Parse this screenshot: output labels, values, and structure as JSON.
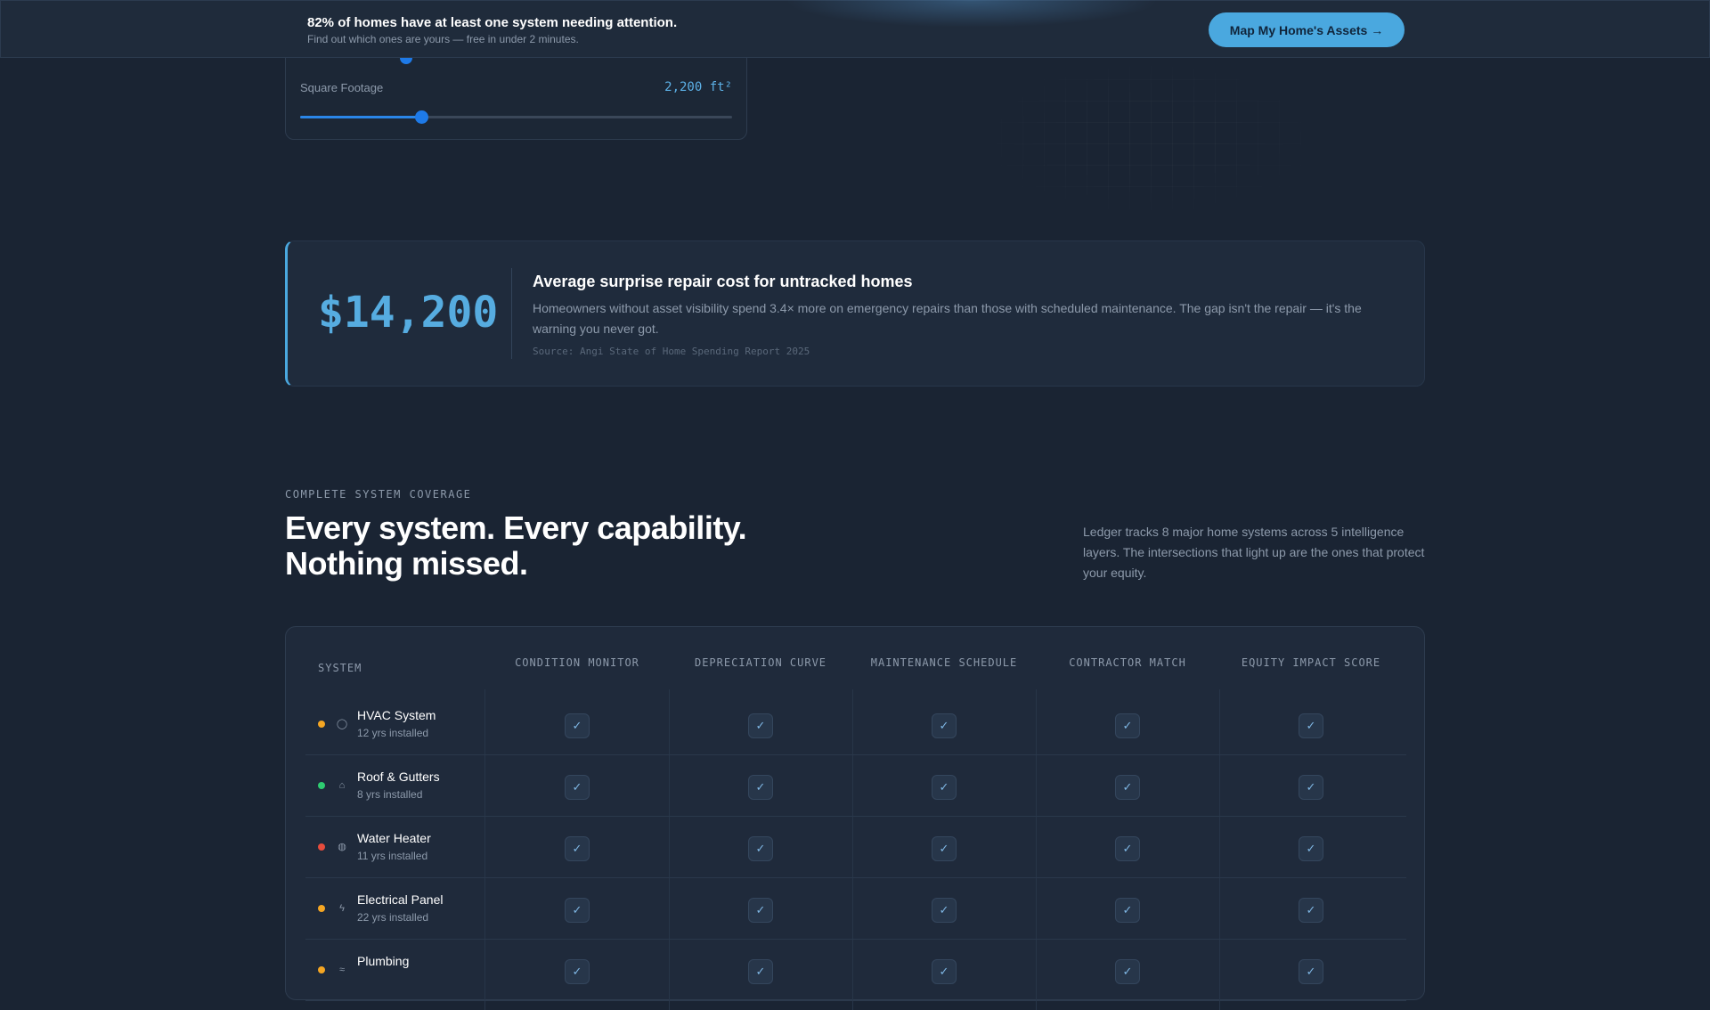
{
  "banner": {
    "title": "82% of homes have at least one system needing attention.",
    "subtitle": "Find out which ones are yours — free in under 2 minutes.",
    "cta": "Map My Home's Assets →"
  },
  "square_footage": {
    "label": "Square Footage",
    "value": "2,200 ft²",
    "slider_fraction": 0.28
  },
  "stat": {
    "amount": "$14,200",
    "heading": "Average surprise repair cost for untracked homes",
    "description": "Homeowners without asset visibility spend 3.4× more on emergency repairs than those with scheduled maintenance. The gap isn't the repair — it's the warning you never got.",
    "source": "Source: Angi State of Home Spending Report 2025"
  },
  "coverage": {
    "eyebrow": "COMPLETE SYSTEM COVERAGE",
    "headline_line1": "Every system. Every capability.",
    "headline_line2": "Nothing missed.",
    "intro": "Ledger tracks 8 major home systems across 5 intelligence layers. The intersections that light up are the ones that protect your equity.",
    "system_header": "SYSTEM",
    "columns": [
      "CONDITION MONITOR",
      "DEPRECIATION CURVE",
      "MAINTENANCE SCHEDULE",
      "CONTRACTOR MATCH",
      "EQUITY IMPACT SCORE"
    ],
    "check_glyph": "✓",
    "rows": [
      {
        "name": "HVAC System",
        "age": "12 yrs installed",
        "status_color": "#f5a623",
        "icon": "thermostat-icon",
        "glyph": "◯"
      },
      {
        "name": "Roof & Gutters",
        "age": "8 yrs installed",
        "status_color": "#2ecc71",
        "icon": "house-icon",
        "glyph": "⌂"
      },
      {
        "name": "Water Heater",
        "age": "11 yrs installed",
        "status_color": "#e74c3c",
        "icon": "flame-icon",
        "glyph": "◍"
      },
      {
        "name": "Electrical Panel",
        "age": "22 yrs installed",
        "status_color": "#f5a623",
        "icon": "lightning-icon",
        "glyph": "ϟ"
      },
      {
        "name": "Plumbing",
        "age": "",
        "status_color": "#f5a623",
        "icon": "pipe-icon",
        "glyph": "≈"
      }
    ]
  },
  "colors": {
    "accent": "#4aa8df",
    "background": "#1a2433"
  }
}
